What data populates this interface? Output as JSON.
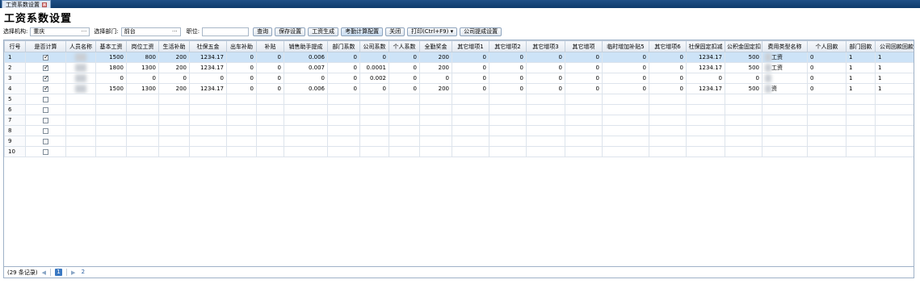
{
  "tab": {
    "label": "工资系数设置"
  },
  "page_title": "工资系数设置",
  "filters": {
    "org_label": "选择机构:",
    "org_value": "重庆",
    "dept_label": "选择部门:",
    "dept_value": "前台",
    "position_label": "职位:",
    "position_value": "",
    "dots": "···"
  },
  "toolbar": {
    "query": "查询",
    "save": "保存设置",
    "salary_gen": "工资生成",
    "attendance": "考勤计算配置",
    "close": "关闭",
    "print": "打印(Ctrl+F9)",
    "company_commission": "公司提成设置"
  },
  "table": {
    "headers": [
      "行号",
      "是否计算",
      "人员名称",
      "基本工资",
      "岗位工资",
      "生活补助",
      "社保五金",
      "出车补助",
      "补贴",
      "销售助手提成",
      "部门系数",
      "公司系数",
      "个人系数",
      "全勤奖金",
      "其它增项1",
      "其它增项2",
      "其它增项3",
      "其它增项",
      "临时增加补贴5",
      "其它增项6",
      "社保固定扣减",
      "公积金固定扣",
      "费用类型名称",
      "个人回款",
      "部门回款",
      "公司回款回款"
    ],
    "rows": [
      {
        "rn": "1",
        "checked": true,
        "name": "",
        "v": [
          "1500",
          "800",
          "200",
          "1234.17",
          "0",
          "0",
          "0.006",
          "0",
          "0",
          "0",
          "200",
          "0",
          "0",
          "0",
          "0",
          "0",
          "0",
          "1234.17",
          "500"
        ],
        "type": "工资",
        "r": [
          "0",
          "1",
          "1"
        ]
      },
      {
        "rn": "2",
        "checked": true,
        "name": "",
        "v": [
          "1800",
          "1300",
          "200",
          "1234.17",
          "0",
          "0",
          "0.007",
          "0",
          "0.0001",
          "0",
          "200",
          "0",
          "0",
          "0",
          "0",
          "0",
          "0",
          "1234.17",
          "500"
        ],
        "type": "工资",
        "r": [
          "0",
          "1",
          "1"
        ]
      },
      {
        "rn": "3",
        "checked": true,
        "name": "",
        "v": [
          "0",
          "0",
          "0",
          "0",
          "0",
          "0",
          "0",
          "0",
          "0.002",
          "0",
          "0",
          "0",
          "0",
          "0",
          "0",
          "0",
          "0",
          "0",
          "0"
        ],
        "type": "",
        "r": [
          "0",
          "1",
          "1"
        ]
      },
      {
        "rn": "4",
        "checked": true,
        "name": "",
        "v": [
          "1500",
          "1300",
          "200",
          "1234.17",
          "0",
          "0",
          "0.006",
          "0",
          "0",
          "0",
          "200",
          "0",
          "0",
          "0",
          "0",
          "0",
          "0",
          "1234.17",
          "500"
        ],
        "type": "资",
        "r": [
          "0",
          "1",
          "1"
        ]
      },
      {
        "rn": "5",
        "checked": false
      },
      {
        "rn": "6",
        "checked": false
      },
      {
        "rn": "7",
        "checked": false
      },
      {
        "rn": "8",
        "checked": false
      },
      {
        "rn": "9",
        "checked": false
      },
      {
        "rn": "10",
        "checked": false
      }
    ]
  },
  "pager": {
    "record_count": "(29 条记录)",
    "current_page": "1",
    "next_page": "2"
  },
  "colors": {
    "selected_row": "#cde3f7",
    "title_bar": "#1f4f86"
  }
}
